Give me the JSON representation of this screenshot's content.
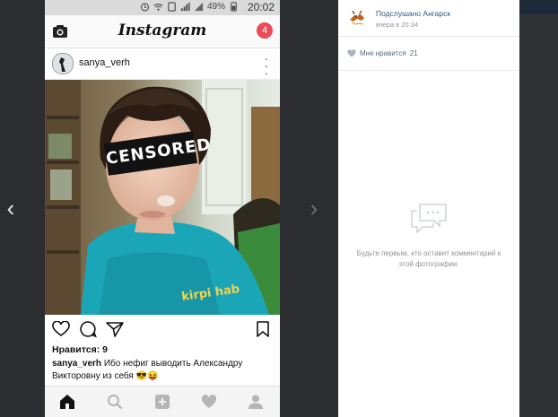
{
  "statusbar": {
    "battery": "49%",
    "time": "20:02"
  },
  "instagram": {
    "logo": "Instagram",
    "notification_count": "4",
    "post": {
      "username": "sanya_verh",
      "photo_overlay": "CENSORED",
      "shirt_text": "kirpi hab",
      "likes": "Нравится: 9",
      "caption_user": "sanya_verh",
      "caption_text": " Ибо нефиг выводить Александру Викторовну из себя 😎😝"
    }
  },
  "vk": {
    "group_name": "Подслушано Ангарск",
    "post_time": "вчера в 20:34",
    "likes_label": "Мне нравится",
    "likes_count": "21",
    "empty_comments_text": "Будьте первым, кто оставит комментарий к этой фотографии."
  },
  "colors": {
    "badge": "#ed4956",
    "vk_link": "#2a5885",
    "viewer_bg": "#2b2d30"
  }
}
